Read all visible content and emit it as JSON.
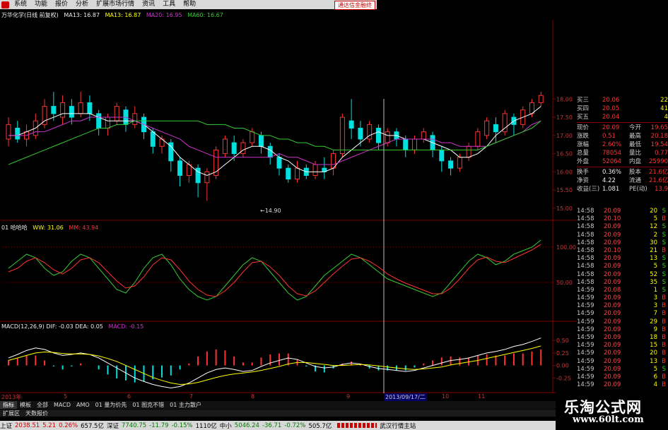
{
  "menu": {
    "items": [
      "系统",
      "功能",
      "报价",
      "分析",
      "扩展市场行情",
      "资讯",
      "工具",
      "帮助"
    ],
    "badge": "通达信金融终"
  },
  "info": {
    "title": "万华化学(日线 前复权)",
    "ma5": "MA13: 16.87",
    "ma13": "MA13: 16.87",
    "ma20": "MA20: 16.95",
    "ma60": "MA60: 16.67"
  },
  "price_axis": [
    "18.00",
    "17.50",
    "17.00",
    "16.50",
    "16.00",
    "15.50",
    "15.00"
  ],
  "low_marker": "14.90",
  "kdj": {
    "name": "01 哈哈哈",
    "ww": "WW: 31.06",
    "mm": "MM: 43.94",
    "axis": [
      "100.00",
      "50.00"
    ]
  },
  "macd": {
    "line1": "MACD(12,26,9) DIF: -0.03  DEA: 0.05",
    "line2": "MACD: -0.15",
    "axis": [
      "0.50",
      "0.25",
      "0.00",
      "-0.25"
    ]
  },
  "time_axis": [
    "2013年",
    "5",
    "6",
    "7",
    "8",
    "9",
    "10",
    "11"
  ],
  "cursor_date": "2013/09/17/二",
  "quote": {
    "rows": [
      {
        "l": "买三",
        "v": "20.06",
        "r": "",
        "n": "22"
      },
      {
        "l": "买四",
        "v": "20.05",
        "r": "",
        "n": "41"
      },
      {
        "l": "买五",
        "v": "20.04",
        "r": "",
        "n": "4"
      }
    ],
    "stats": [
      {
        "l": "现价",
        "v": "20.09",
        "r": "今开",
        "n": "19.65"
      },
      {
        "l": "涨跌",
        "v": "0.51",
        "r": "最高",
        "n": "20.18"
      },
      {
        "l": "涨幅",
        "v": "2.60%",
        "r": "最低",
        "n": "19.54"
      },
      {
        "l": "总量",
        "v": "78054",
        "r": "量比",
        "n": "0.77"
      },
      {
        "l": "外盘",
        "v": "52064",
        "r": "内盘",
        "n": "25990"
      }
    ],
    "extra": [
      {
        "l": "换手",
        "v": "0.36%",
        "r": "股本",
        "n": "21.6亿"
      },
      {
        "l": "净资",
        "v": "4.22",
        "r": "流通",
        "n": "21.6亿"
      },
      {
        "l": "收益(三)",
        "v": "1.081",
        "r": "PE(动)",
        "n": "13.9"
      }
    ]
  },
  "trades": [
    {
      "t": "14:58",
      "p": "20.09",
      "v": "20",
      "s": "S"
    },
    {
      "t": "14:58",
      "p": "20.10",
      "v": "5",
      "s": "B"
    },
    {
      "t": "14:58",
      "p": "20.09",
      "v": "12",
      "s": "S"
    },
    {
      "t": "14:58",
      "p": "20.09",
      "v": "2",
      "s": "S"
    },
    {
      "t": "14:58",
      "p": "20.09",
      "v": "30",
      "s": "S"
    },
    {
      "t": "14:58",
      "p": "20.10",
      "v": "21",
      "s": "B"
    },
    {
      "t": "14:58",
      "p": "20.09",
      "v": "13",
      "s": "S"
    },
    {
      "t": "14:58",
      "p": "20.09",
      "v": "5",
      "s": "S"
    },
    {
      "t": "14:58",
      "p": "20.09",
      "v": "52",
      "s": "S"
    },
    {
      "t": "14:58",
      "p": "20.09",
      "v": "35",
      "s": "S"
    },
    {
      "t": "14:59",
      "p": "20.08",
      "v": "1",
      "s": "S"
    },
    {
      "t": "14:59",
      "p": "20.09",
      "v": "3",
      "s": "B"
    },
    {
      "t": "14:59",
      "p": "20.09",
      "v": "3",
      "s": "B"
    },
    {
      "t": "14:59",
      "p": "20.09",
      "v": "7",
      "s": "B"
    },
    {
      "t": "14:59",
      "p": "20.09",
      "v": "29",
      "s": "B"
    },
    {
      "t": "14:59",
      "p": "20.09",
      "v": "9",
      "s": "B"
    },
    {
      "t": "14:59",
      "p": "20.09",
      "v": "18",
      "s": "B"
    },
    {
      "t": "14:59",
      "p": "20.09",
      "v": "15",
      "s": "B"
    },
    {
      "t": "14:59",
      "p": "20.09",
      "v": "20",
      "s": "B"
    },
    {
      "t": "14:59",
      "p": "20.09",
      "v": "13",
      "s": "B"
    },
    {
      "t": "14:59",
      "p": "20.09",
      "v": "5",
      "s": "S"
    },
    {
      "t": "14:59",
      "p": "20.09",
      "v": "6",
      "s": "B"
    },
    {
      "t": "14:59",
      "p": "20.09",
      "v": "4",
      "s": "B"
    }
  ],
  "tabs": [
    "指标",
    "模板",
    "全部",
    "MACD",
    "AMO",
    "01 量为价先",
    "01 图克不错",
    "01 主力散户"
  ],
  "lowbar": [
    "扩展区",
    "天数报价"
  ],
  "status": {
    "sh_label": "上证",
    "sh_val": "2038.51",
    "sh_chg": "5.21",
    "sh_pct": "0.26%",
    "sh_amt": "657.5亿",
    "sz_label": "深证",
    "sz_val": "7740.75",
    "sz_chg": "-11.79",
    "sz_pct": "-0.15%",
    "sz_amt": "1110亿",
    "zx_label": "中小",
    "zx_val": "5046.24",
    "zx_chg": "-36.71",
    "zx_pct": "-0.72%",
    "zx_amt": "505.7亿",
    "station": "武汉行情主站"
  },
  "watermark": {
    "cn": "乐淘公式网",
    "url": "www.60lt.com"
  },
  "colors": {
    "up": "#ff3333",
    "down": "#00e0e0",
    "ma5": "#ffffff",
    "ma13": "#ffff00",
    "ma20": "#cc33cc",
    "ma60": "#33cc33",
    "grid": "#800000"
  },
  "chart_data": {
    "type": "candlestick",
    "price_range": [
      14.9,
      18.2
    ],
    "candles": [
      [
        16.9,
        17.3,
        16.7,
        17.5
      ],
      [
        17.2,
        16.9,
        16.8,
        17.4
      ],
      [
        16.9,
        17.1,
        16.7,
        17.3
      ],
      [
        17.0,
        17.4,
        16.9,
        17.6
      ],
      [
        17.3,
        17.8,
        17.2,
        18.0
      ],
      [
        17.8,
        17.6,
        17.4,
        18.2
      ],
      [
        17.5,
        17.9,
        17.3,
        18.1
      ],
      [
        17.8,
        17.5,
        17.3,
        18.0
      ],
      [
        17.6,
        17.9,
        17.5,
        18.2
      ],
      [
        17.9,
        17.6,
        17.4,
        18.1
      ],
      [
        17.6,
        17.2,
        17.0,
        17.7
      ],
      [
        17.2,
        17.5,
        17.0,
        17.6
      ],
      [
        17.4,
        17.8,
        17.3,
        17.9
      ],
      [
        17.7,
        17.3,
        17.1,
        17.8
      ],
      [
        17.3,
        17.6,
        17.2,
        17.8
      ],
      [
        17.5,
        17.1,
        16.9,
        17.6
      ],
      [
        17.1,
        16.7,
        16.5,
        17.2
      ],
      [
        16.7,
        16.9,
        16.5,
        17.0
      ],
      [
        16.8,
        16.3,
        16.0,
        16.9
      ],
      [
        16.3,
        15.9,
        15.6,
        16.4
      ],
      [
        15.9,
        16.2,
        15.7,
        16.3
      ],
      [
        16.1,
        15.7,
        15.3,
        16.2
      ],
      [
        15.7,
        16.0,
        15.2,
        16.1
      ],
      [
        15.9,
        16.6,
        15.8,
        16.7
      ],
      [
        16.5,
        16.9,
        16.4,
        17.0
      ],
      [
        16.8,
        16.5,
        16.3,
        17.0
      ],
      [
        16.5,
        16.8,
        16.4,
        16.9
      ],
      [
        16.8,
        17.1,
        16.7,
        17.2
      ],
      [
        17.0,
        16.7,
        16.5,
        17.1
      ],
      [
        16.7,
        16.4,
        16.2,
        16.8
      ],
      [
        16.4,
        16.1,
        15.9,
        16.5
      ],
      [
        16.1,
        15.8,
        15.7,
        16.2
      ],
      [
        15.8,
        16.1,
        15.7,
        16.3
      ],
      [
        16.1,
        15.9,
        15.8,
        16.2
      ],
      [
        15.9,
        16.2,
        15.8,
        16.3
      ],
      [
        16.1,
        16.0,
        15.8,
        16.4
      ],
      [
        16.1,
        16.5,
        15.9,
        16.6
      ],
      [
        16.5,
        17.5,
        16.4,
        17.6
      ],
      [
        17.4,
        17.2,
        16.9,
        18.0
      ],
      [
        17.2,
        16.9,
        16.7,
        17.4
      ],
      [
        16.9,
        17.3,
        16.8,
        17.4
      ],
      [
        17.2,
        16.8,
        16.6,
        17.3
      ],
      [
        16.8,
        17.1,
        16.7,
        17.2
      ],
      [
        17.1,
        16.9,
        16.7,
        17.2
      ],
      [
        16.9,
        16.6,
        16.4,
        17.0
      ],
      [
        16.6,
        16.9,
        16.5,
        17.0
      ],
      [
        16.9,
        17.1,
        16.8,
        17.2
      ],
      [
        17.0,
        16.6,
        16.4,
        17.1
      ],
      [
        16.6,
        16.3,
        16.0,
        16.7
      ],
      [
        16.3,
        16.1,
        15.9,
        16.4
      ],
      [
        16.1,
        16.4,
        16.0,
        16.5
      ],
      [
        16.4,
        16.7,
        16.3,
        16.8
      ],
      [
        16.7,
        17.1,
        16.6,
        17.2
      ],
      [
        17.0,
        17.4,
        16.9,
        17.5
      ],
      [
        17.3,
        17.1,
        16.8,
        17.5
      ],
      [
        17.1,
        17.6,
        17.0,
        17.7
      ],
      [
        17.5,
        17.3,
        17.0,
        17.6
      ],
      [
        17.3,
        17.7,
        17.2,
        17.8
      ],
      [
        17.6,
        17.9,
        17.5,
        18.0
      ],
      [
        17.9,
        18.1,
        17.8,
        18.2
      ]
    ],
    "ma": {
      "ma5": [
        17.0,
        17.0,
        17.1,
        17.2,
        17.4,
        17.5,
        17.6,
        17.6,
        17.6,
        17.6,
        17.5,
        17.4,
        17.4,
        17.4,
        17.4,
        17.3,
        17.1,
        16.9,
        16.7,
        16.4,
        16.2,
        16.0,
        15.9,
        16.0,
        16.2,
        16.4,
        16.6,
        16.7,
        16.7,
        16.6,
        16.4,
        16.3,
        16.1,
        16.0,
        16.0,
        16.0,
        16.1,
        16.4,
        16.6,
        16.8,
        17.0,
        17.1,
        17.0,
        17.0,
        16.9,
        16.9,
        16.9,
        16.8,
        16.7,
        16.6,
        16.4,
        16.4,
        16.5,
        16.7,
        17.0,
        17.2,
        17.4,
        17.5,
        17.6,
        17.8
      ],
      "ma13": [
        17.0,
        17.0,
        17.0,
        17.1,
        17.1,
        17.2,
        17.3,
        17.4,
        17.4,
        17.5,
        17.5,
        17.5,
        17.5,
        17.5,
        17.4,
        17.3,
        17.2,
        17.1,
        17.0,
        16.9,
        16.7,
        16.6,
        16.5,
        16.4,
        16.4,
        16.4,
        16.4,
        16.4,
        16.4,
        16.4,
        16.5,
        16.4,
        16.4,
        16.3,
        16.2,
        16.2,
        16.2,
        16.3,
        16.4,
        16.5,
        16.6,
        16.7,
        16.8,
        16.9,
        16.9,
        16.9,
        16.9,
        16.9,
        16.8,
        16.8,
        16.7,
        16.7,
        16.7,
        16.7,
        16.8,
        16.9,
        17.0,
        17.1,
        17.3,
        17.4
      ],
      "ma60": [
        16.2,
        16.3,
        16.4,
        16.5,
        16.6,
        16.7,
        16.8,
        16.9,
        17.0,
        17.1,
        17.2,
        17.2,
        17.3,
        17.3,
        17.4,
        17.4,
        17.4,
        17.4,
        17.4,
        17.4,
        17.4,
        17.4,
        17.3,
        17.3,
        17.3,
        17.2,
        17.2,
        17.1,
        17.0,
        17.0,
        16.9,
        16.9,
        16.8,
        16.8,
        16.7,
        16.7,
        16.6,
        16.6,
        16.6,
        16.6,
        16.6,
        16.6,
        16.6,
        16.6,
        16.6,
        16.6,
        16.6,
        16.6,
        16.6,
        16.6,
        16.6,
        16.6,
        16.6,
        16.7,
        16.8,
        16.9,
        17.0,
        17.1,
        17.2,
        17.4
      ]
    },
    "kdj_ww": [
      70,
      80,
      90,
      85,
      70,
      60,
      65,
      80,
      90,
      85,
      70,
      55,
      40,
      35,
      50,
      70,
      85,
      90,
      75,
      55,
      40,
      30,
      25,
      30,
      45,
      60,
      75,
      85,
      80,
      65,
      50,
      35,
      25,
      30,
      45,
      60,
      70,
      80,
      90,
      85,
      75,
      65,
      55,
      50,
      45,
      40,
      35,
      30,
      35,
      50,
      65,
      80,
      90,
      85,
      75,
      80,
      90,
      95,
      100,
      110
    ],
    "kdj_mm": [
      65,
      70,
      80,
      85,
      78,
      68,
      62,
      70,
      82,
      85,
      78,
      65,
      52,
      42,
      45,
      58,
      75,
      85,
      82,
      68,
      52,
      40,
      32,
      30,
      38,
      50,
      65,
      78,
      80,
      72,
      60,
      45,
      34,
      31,
      38,
      50,
      62,
      73,
      83,
      85,
      80,
      72,
      62,
      55,
      49,
      44,
      39,
      34,
      34,
      42,
      55,
      70,
      82,
      86,
      80,
      78,
      84,
      90,
      96,
      104
    ],
    "macd_dif": [
      0.15,
      0.22,
      0.3,
      0.35,
      0.32,
      0.25,
      0.2,
      0.22,
      0.25,
      0.22,
      0.15,
      0.05,
      -0.05,
      -0.15,
      -0.25,
      -0.32,
      -0.38,
      -0.42,
      -0.45,
      -0.42,
      -0.35,
      -0.25,
      -0.15,
      -0.08,
      -0.05,
      -0.08,
      -0.12,
      -0.1,
      -0.02,
      0.05,
      0.1,
      0.15,
      0.12,
      0.05,
      -0.02,
      -0.05,
      -0.03,
      0.02,
      0.05,
      0.03,
      -0.02,
      -0.06,
      -0.08,
      -0.1,
      -0.12,
      -0.1,
      -0.05,
      0.0,
      0.05,
      0.1,
      0.12,
      0.15,
      0.2,
      0.25,
      0.28,
      0.32,
      0.38,
      0.42,
      0.48,
      0.55
    ],
    "macd_dea": [
      0.1,
      0.15,
      0.2,
      0.25,
      0.27,
      0.26,
      0.24,
      0.23,
      0.23,
      0.22,
      0.19,
      0.14,
      0.08,
      0.0,
      -0.08,
      -0.16,
      -0.24,
      -0.3,
      -0.35,
      -0.38,
      -0.37,
      -0.34,
      -0.29,
      -0.24,
      -0.2,
      -0.17,
      -0.15,
      -0.13,
      -0.1,
      -0.06,
      -0.02,
      0.03,
      0.06,
      0.06,
      0.04,
      0.02,
      0.0,
      0.0,
      0.01,
      0.02,
      0.01,
      -0.01,
      -0.03,
      -0.05,
      -0.07,
      -0.08,
      -0.07,
      -0.05,
      -0.03,
      0.01,
      0.04,
      0.07,
      0.1,
      0.14,
      0.18,
      0.22,
      0.26,
      0.3,
      0.34,
      0.39
    ],
    "macd_range": [
      -0.5,
      0.7
    ]
  }
}
